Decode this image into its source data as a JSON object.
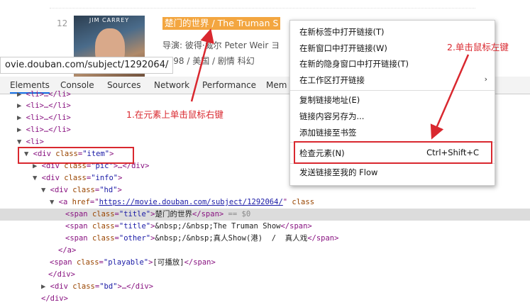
{
  "page": {
    "row_number": "12",
    "poster_caption": "JIM CARREY",
    "title": "楚门的世界  / The Truman S",
    "director_line": "导演: 彼得·威尔 Peter Weir   ヨ",
    "info_line": "1998 / 美国 / 剧情 科幻",
    "url_tooltip": "ovie.douban.com/subject/1292064/"
  },
  "devtools": {
    "tabs": [
      "Elements",
      "Console",
      "Sources",
      "Network",
      "Performance",
      "Mem"
    ],
    "lines": {
      "l1": "<li>…</li>",
      "l2": "<li>…</li>",
      "l3": "<li>…</li>",
      "l4": "<li>…</li>",
      "l5": "<li>",
      "div_item_open": "<div ",
      "div_item_attr": "class",
      "div_item_val": "\"item\"",
      "pic_a": "<div ",
      "pic_attr": "class",
      "pic_val": "\"pic\"",
      "pic_rest": ">…</div>",
      "info_a": "<div ",
      "info_attr": "class",
      "info_val": "\"info\"",
      "hd_a": "<div ",
      "hd_attr": "class",
      "hd_val": "\"hd\"",
      "a_open": "<a ",
      "a_href_attr": "href",
      "a_href_val": "https://movie.douban.com/subject/1292064/",
      "a_class": " class",
      "span1_attr": "class",
      "span1_val": "\"title\"",
      "span1_text": "楚门的世界",
      "span1_close": "</span>",
      "span1_eq": " == $0",
      "span2_val": "\"title\"",
      "span2_nbsp": "&nbsp;/&nbsp;",
      "span2_text": "The Truman Show",
      "span3_val": "\"other\"",
      "span3_nbsp": "&nbsp;/&nbsp;",
      "span3_text": "真人Show(港)  /  真人戏",
      "a_close": "</a>",
      "play_val": "\"playable\"",
      "play_text": "[可播放]",
      "div_close1": "</div>",
      "bd_val": "\"bd\"",
      "bd_rest": ">…</div>",
      "div_close2": "</div>"
    }
  },
  "context_menu": {
    "items": [
      "在新标签中打开链接(T)",
      "在新窗口中打开链接(W)",
      "在新的隐身窗口中打开链接(T)",
      "在工作区打开链接",
      "复制链接地址(E)",
      "链接内容另存为...",
      "添加链接至书签",
      "检查元素(N)",
      "发送链接至我的 Flow"
    ],
    "inspect_shortcut": "Ctrl+Shift+C"
  },
  "annotations": {
    "step1": "1.在元素上单击鼠标右键",
    "step2": "2.单击鼠标左键"
  },
  "colors": {
    "annotation": "#d9282f",
    "highlight": "#f3a640",
    "link": "#1a1aa6",
    "tag": "#881280",
    "attr": "#994500"
  }
}
